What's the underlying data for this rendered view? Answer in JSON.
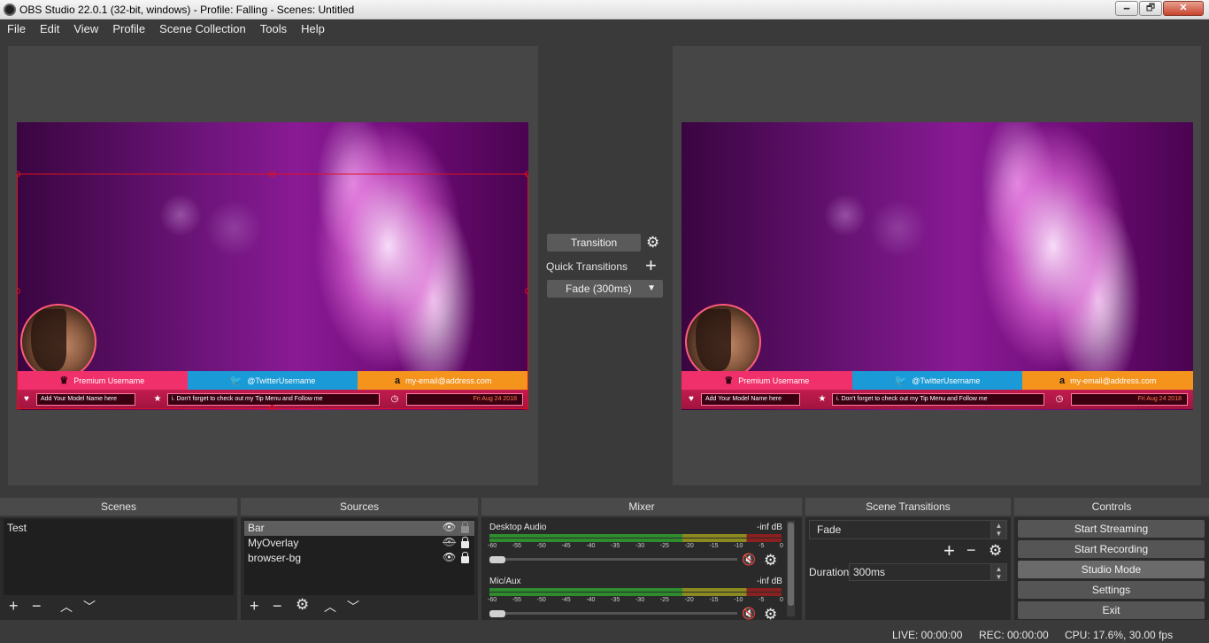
{
  "window": {
    "title": "OBS Studio 22.0.1 (32-bit, windows) - Profile: Falling - Scenes: Untitled",
    "minimize": "🗕",
    "maximize": "🗗",
    "close": "✕"
  },
  "menu": [
    "File",
    "Edit",
    "View",
    "Profile",
    "Scene Collection",
    "Tools",
    "Help"
  ],
  "overlay": {
    "username": "Premium Username",
    "twitter": "@TwitterUsername",
    "email": "my-email@address.com",
    "model_name": "Add Your Model Name here",
    "ticker": "i. Don't forget to check out my Tip Menu and Follow me",
    "date": "Fri Aug 24 2018"
  },
  "transition": {
    "button": "Transition",
    "quick_label": "Quick Transitions",
    "fade_option": "Fade (300ms)"
  },
  "docks": {
    "scenes": "Scenes",
    "sources": "Sources",
    "mixer": "Mixer",
    "scene_transitions": "Scene Transitions",
    "controls": "Controls"
  },
  "scenes": [
    "Test"
  ],
  "sources": [
    {
      "name": "Bar",
      "visible": true,
      "locked": false
    },
    {
      "name": "MyOverlay",
      "visible": false,
      "locked": true
    },
    {
      "name": "browser-bg",
      "visible": true,
      "locked": true
    }
  ],
  "mixer": {
    "tracks": [
      {
        "name": "Desktop Audio",
        "db": "-inf dB",
        "muted": true
      },
      {
        "name": "Mic/Aux",
        "db": "-inf dB",
        "muted": true
      }
    ],
    "ticks": [
      "-60",
      "-55",
      "-50",
      "-45",
      "-40",
      "-35",
      "-30",
      "-25",
      "-20",
      "-15",
      "-10",
      "-5",
      "0"
    ]
  },
  "scene_transitions": {
    "selected": "Fade",
    "duration_label": "Duration",
    "duration_value": "300ms"
  },
  "controls": {
    "start_streaming": "Start Streaming",
    "start_recording": "Start Recording",
    "studio_mode": "Studio Mode",
    "settings": "Settings",
    "exit": "Exit"
  },
  "status": {
    "live": "LIVE: 00:00:00",
    "rec": "REC: 00:00:00",
    "cpu": "CPU: 17.6%, 30.00 fps"
  },
  "colors": {
    "accent_pink": "#f0306a",
    "accent_blue": "#1a9ad6",
    "accent_orange": "#f4941c",
    "selection_red": "#e01020",
    "mute_red": "#e23838"
  }
}
